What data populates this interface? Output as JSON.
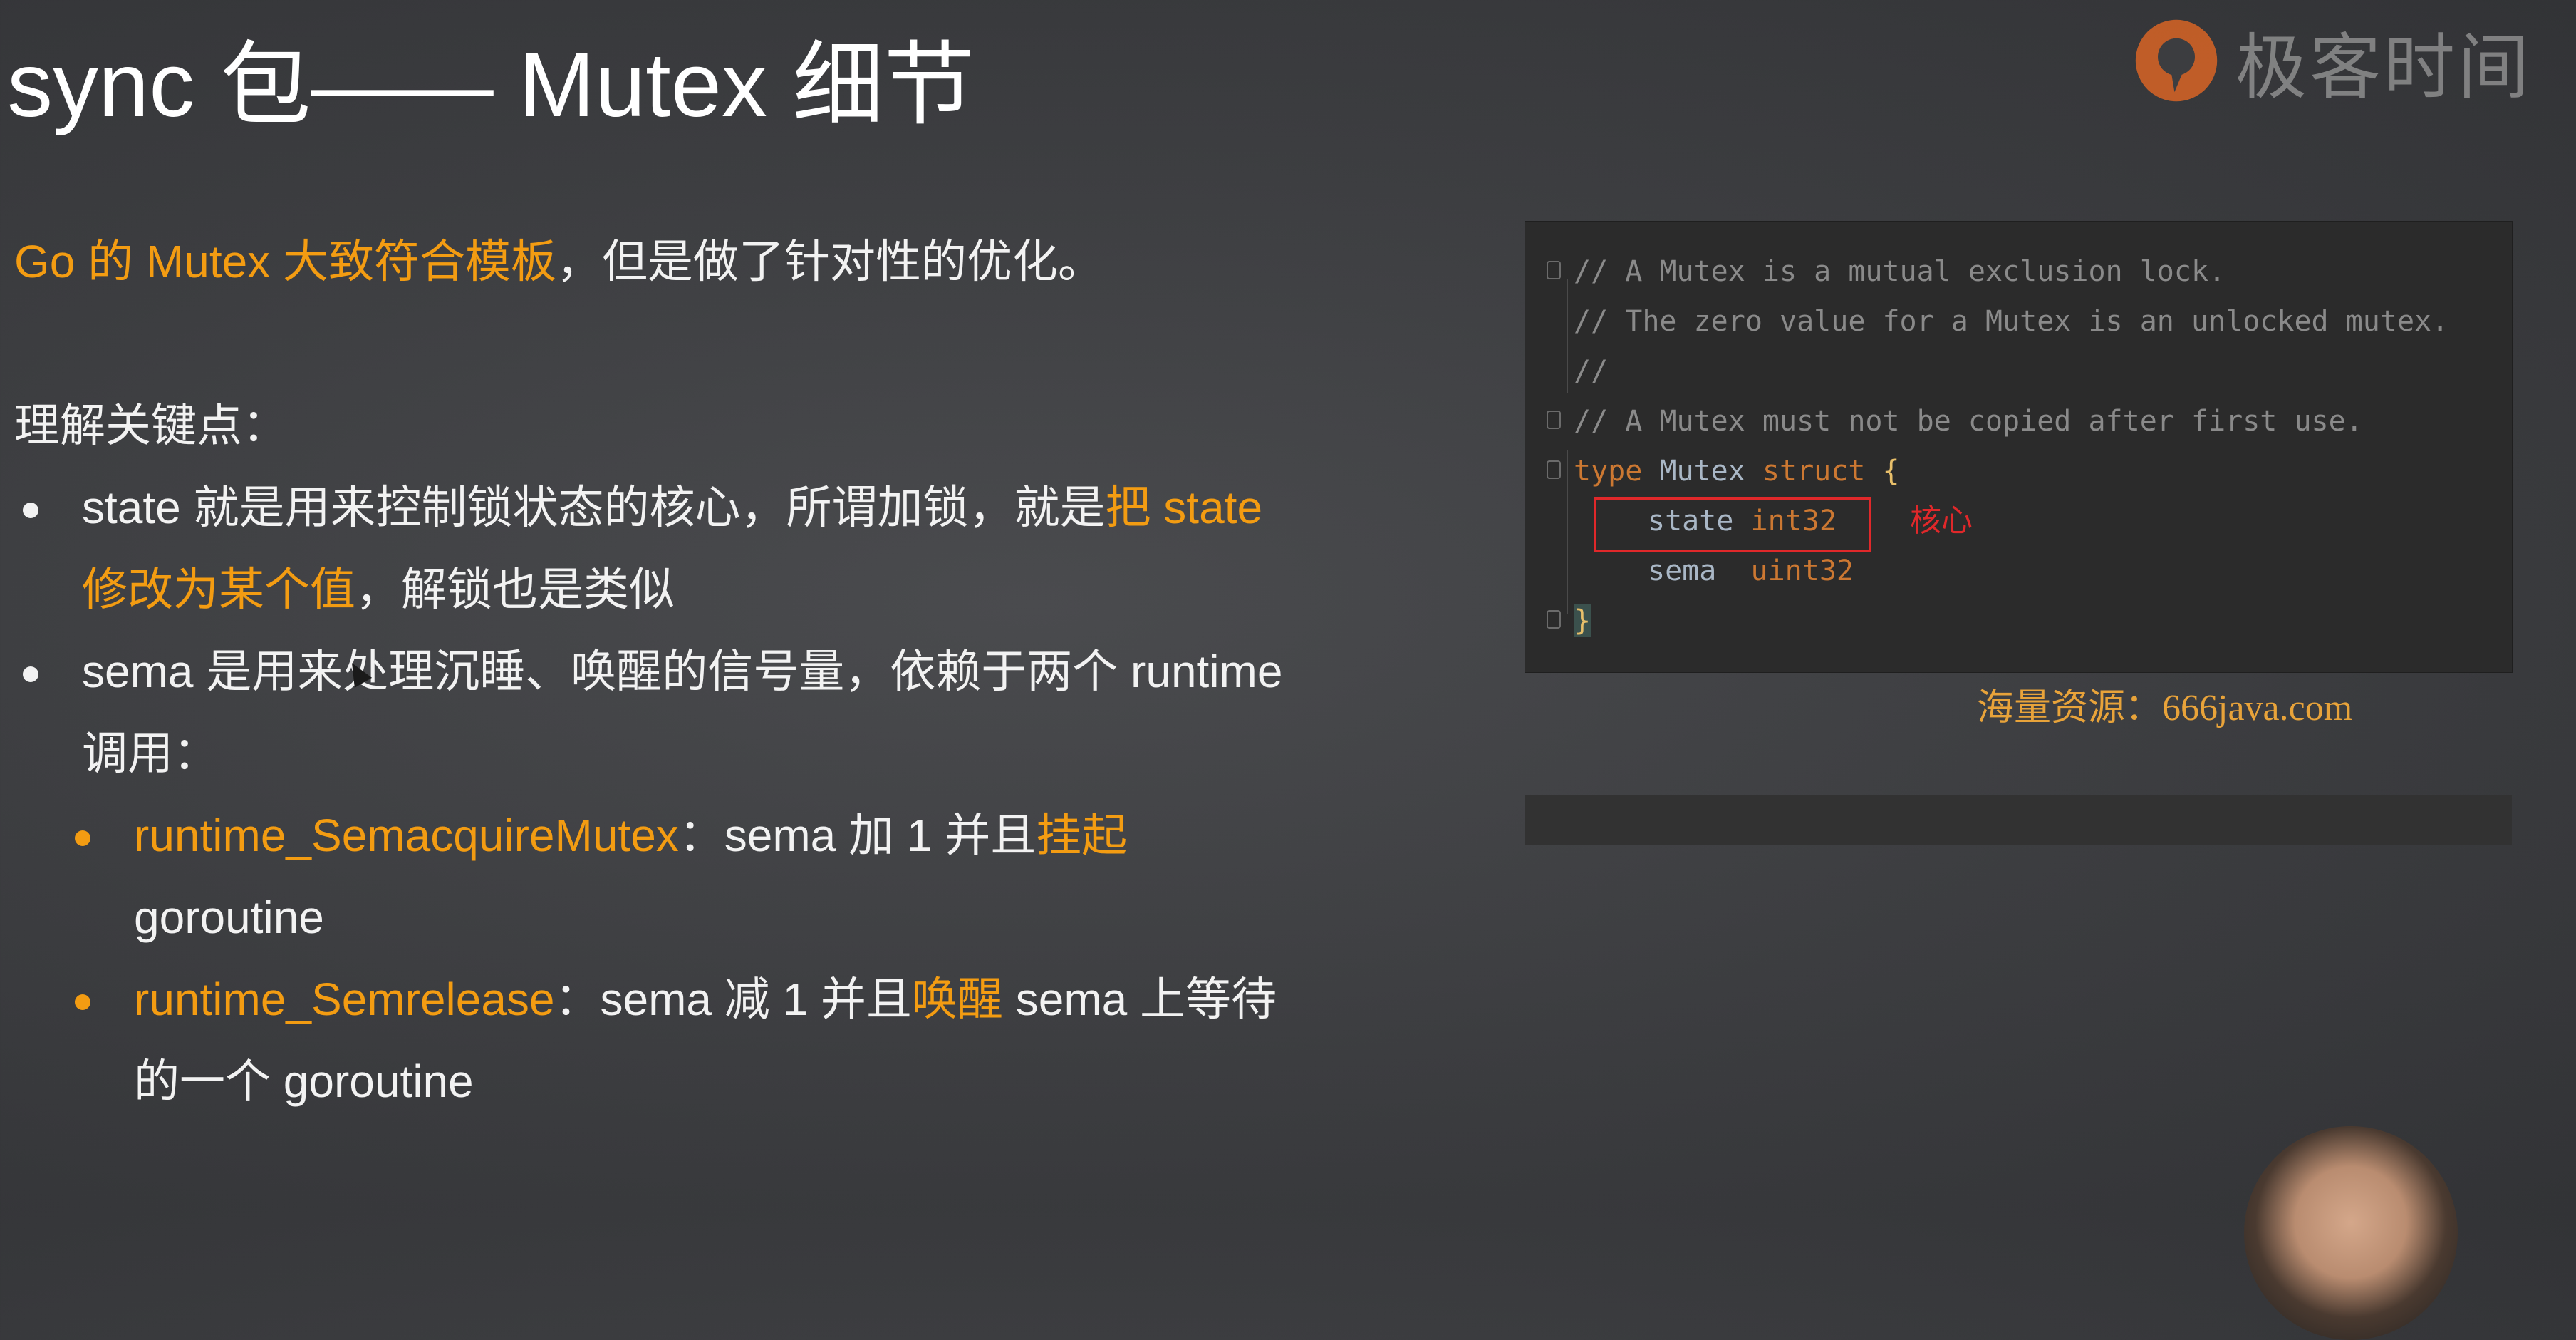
{
  "slide": {
    "title": "sync 包—— Mutex 细节",
    "logo_text": "极客时间",
    "intro": {
      "highlight": "Go 的 Mutex 大致符合模板",
      "rest": "，但是做了针对性的优化。"
    },
    "key_points_heading": "理解关键点：",
    "bullet1": {
      "part1": "state 就是用来控制锁状态的核心，所谓加锁，就是",
      "highlight": "把 state 修改为某个值",
      "part2": "，解锁也是类似"
    },
    "bullet2": {
      "text": "sema 是用来处理沉睡、唤醒的信号量，依赖于两个 runtime 调用："
    },
    "sub1": {
      "name": "runtime_SemacquireMutex",
      "mid": "：sema 加 1 并且",
      "highlight": "挂起",
      "end": " goroutine"
    },
    "sub2": {
      "name": "runtime_Semrelease",
      "mid": "：sema 减 1 并且",
      "highlight": "唤醒",
      "end": " sema 上等待的一个 goroutine"
    }
  },
  "code": {
    "line1": "// A Mutex is a mutual exclusion lock.",
    "line2": "// The zero value for a Mutex is an unlocked mutex.",
    "line3": "//",
    "line4": "// A Mutex must not be copied after first use.",
    "line5_kw1": "type",
    "line5_name": " Mutex ",
    "line5_kw2": "struct",
    "line5_brace": "{",
    "field1_name": "state",
    "field1_type": "int32",
    "field2_name": "sema",
    "field2_type": "uint32",
    "close_brace": "}",
    "annotation": "核心"
  },
  "watermark": "海量资源：666java.com",
  "colors": {
    "accent": "#f39c12",
    "highlight_red": "#e0282a",
    "code_bg": "#2b2b2b"
  }
}
